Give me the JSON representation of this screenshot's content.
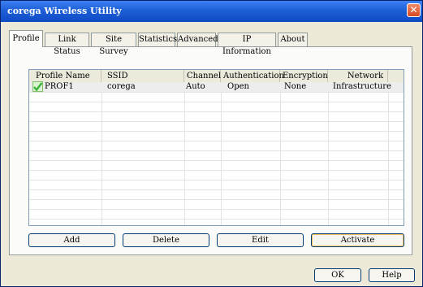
{
  "window": {
    "title": "corega Wireless Utility",
    "close_glyph": "✕"
  },
  "tabs": [
    {
      "label": "Profile"
    },
    {
      "label": "Link Status"
    },
    {
      "label": "Site Survey"
    },
    {
      "label": "Statistics"
    },
    {
      "label": "Advanced"
    },
    {
      "label": "IP Information"
    },
    {
      "label": "About"
    }
  ],
  "profile_list": {
    "columns": [
      "Profile Name",
      "SSID",
      "Channel",
      "Authentication",
      "Encryption",
      "Network Type"
    ],
    "rows": [
      {
        "active_icon": "check-icon",
        "cells": [
          "PROF1",
          "corega",
          "Auto",
          "Open",
          "None",
          "Infrastructure"
        ]
      }
    ]
  },
  "actions": {
    "add": "Add",
    "delete": "Delete",
    "edit": "Edit",
    "activate": "Activate"
  },
  "footer": {
    "ok": "OK",
    "help": "Help"
  },
  "colors": {
    "titlebar": "#1f5fd6",
    "check": "#3bb33b",
    "selected_row": "#ededed"
  }
}
